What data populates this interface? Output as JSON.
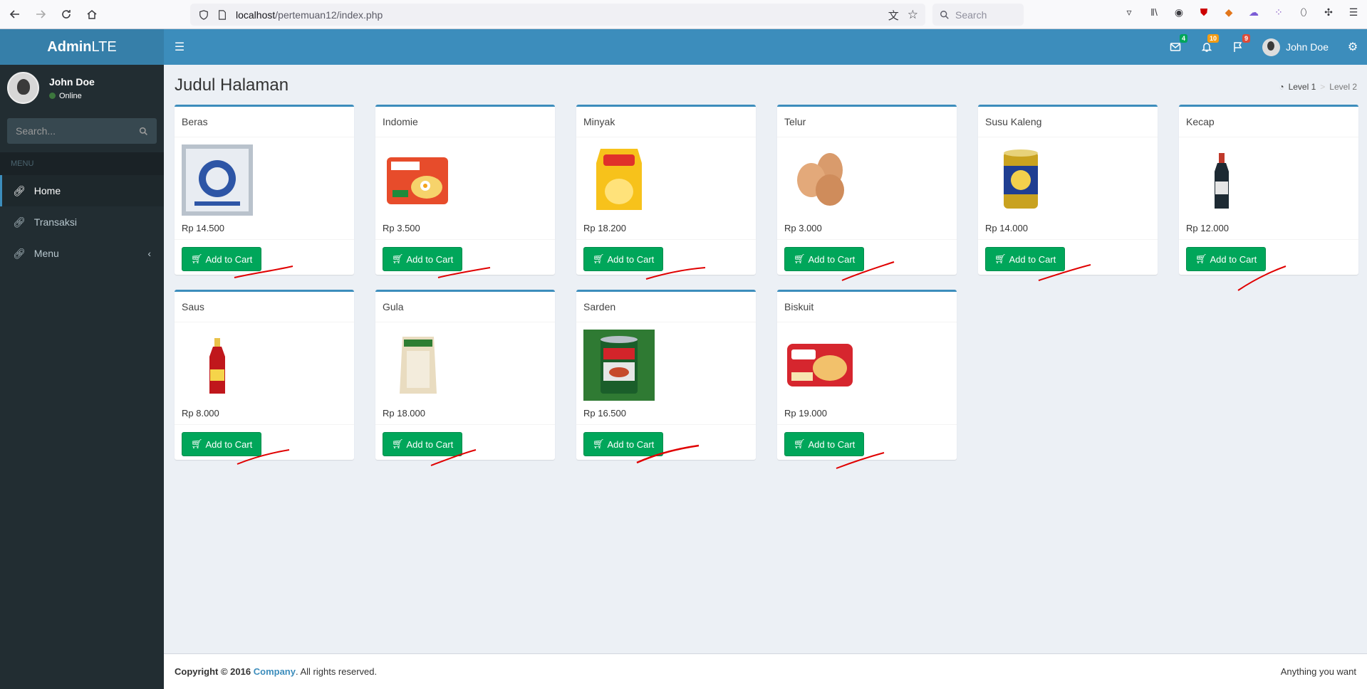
{
  "browser": {
    "url_host": "localhost",
    "url_path": "/pertemuan12/index.php",
    "search_placeholder": "Search"
  },
  "brand": {
    "bold": "Admin",
    "light": "LTE"
  },
  "user": {
    "name": "John Doe",
    "status": "Online"
  },
  "sidebar": {
    "search_placeholder": "Search...",
    "menu_header": "MENU",
    "items": [
      {
        "label": "Home",
        "icon": "link-icon",
        "active": true
      },
      {
        "label": "Transaksi",
        "icon": "link-icon",
        "active": false
      },
      {
        "label": "Menu",
        "icon": "link-icon",
        "active": false,
        "caret": "‹"
      }
    ]
  },
  "header": {
    "badges": {
      "messages": "4",
      "notifications": "10",
      "tasks": "9"
    },
    "user_name": "John Doe"
  },
  "page": {
    "title": "Judul Halaman",
    "breadcrumb": {
      "level1": "Level 1",
      "level2": "Level 2"
    }
  },
  "products": [
    {
      "name": "Beras",
      "price": "Rp 14.500",
      "button": "Add to Cart",
      "image": "rice-sack"
    },
    {
      "name": "Indomie",
      "price": "Rp 3.500",
      "button": "Add to Cart",
      "image": "noodle-pack"
    },
    {
      "name": "Minyak",
      "price": "Rp 18.200",
      "button": "Add to Cart",
      "image": "oil-pouch"
    },
    {
      "name": "Telur",
      "price": "Rp 3.000",
      "button": "Add to Cart",
      "image": "eggs"
    },
    {
      "name": "Susu Kaleng",
      "price": "Rp 14.000",
      "button": "Add to Cart",
      "image": "milk-can"
    },
    {
      "name": "Kecap",
      "price": "Rp 12.000",
      "button": "Add to Cart",
      "image": "soy-bottle"
    },
    {
      "name": "Saus",
      "price": "Rp 8.000",
      "button": "Add to Cart",
      "image": "sauce-bottle"
    },
    {
      "name": "Gula",
      "price": "Rp 18.000",
      "button": "Add to Cart",
      "image": "sugar-pack"
    },
    {
      "name": "Sarden",
      "price": "Rp 16.500",
      "button": "Add to Cart",
      "image": "sardine-can"
    },
    {
      "name": "Biskuit",
      "price": "Rp 19.000",
      "button": "Add to Cart",
      "image": "biscuit-pack"
    }
  ],
  "footer": {
    "copyright": "Copyright © 2016",
    "company": "Company",
    "rights": ". All rights reserved.",
    "right_text": "Anything you want"
  },
  "colors": {
    "header": "#3c8dbc",
    "logo": "#367fa9",
    "sidebar": "#222d32",
    "button": "#00a65a",
    "annotation": "#e00000"
  }
}
